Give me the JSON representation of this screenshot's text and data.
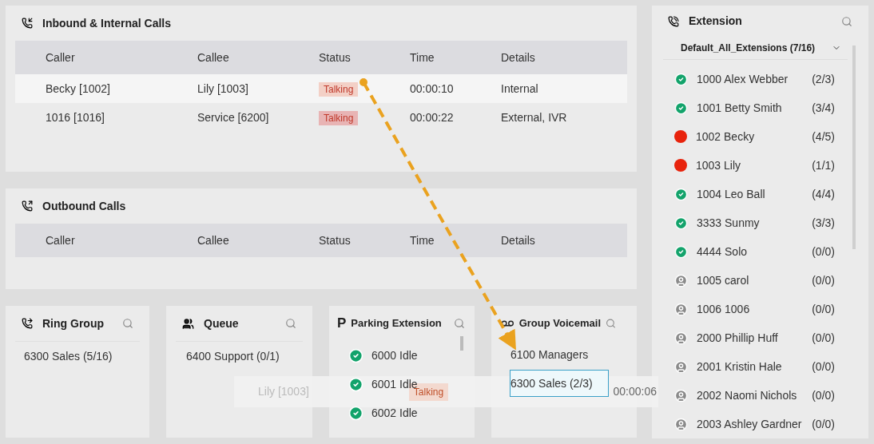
{
  "inbound": {
    "title": "Inbound & Internal Calls",
    "columns": [
      "Caller",
      "Callee",
      "Status",
      "Time",
      "Details"
    ],
    "rows": [
      {
        "caller": "Becky [1002]",
        "callee": "Lily [1003]",
        "status": "Talking",
        "time": "00:00:10",
        "details": "Internal",
        "selected": true
      },
      {
        "caller": "1016 [1016]",
        "callee": "Service [6200]",
        "status": "Talking",
        "time": "00:00:22",
        "details": "External, IVR",
        "selected": false
      }
    ]
  },
  "outbound": {
    "title": "Outbound Calls",
    "columns": [
      "Caller",
      "Callee",
      "Status",
      "Time",
      "Details"
    ]
  },
  "ring_group": {
    "title": "Ring Group",
    "items": [
      "6300 Sales (5/16)"
    ]
  },
  "queue": {
    "title": "Queue",
    "items": [
      "6400 Support (0/1)"
    ]
  },
  "parking": {
    "icon": "P",
    "title": "Parking Extension",
    "items": [
      "6000 Idle",
      "6001 Idle",
      "6002 Idle"
    ]
  },
  "group_voicemail": {
    "title": "Group Voicemail",
    "items": [
      {
        "label": "6100 Managers",
        "highlighted": false
      },
      {
        "label": "6300 Sales (2/3)",
        "highlighted": true
      }
    ]
  },
  "drag_ghost": {
    "callee": "Lily [1003]",
    "status": "Talking",
    "time": "00:00:06"
  },
  "extension": {
    "title": "Extension",
    "group": "Default_All_Extensions (7/16)",
    "items": [
      {
        "name": "1000 Alex Webber",
        "count": "(2/3)",
        "kind": "available"
      },
      {
        "name": "1001 Betty Smith",
        "count": "(3/4)",
        "kind": "available"
      },
      {
        "name": "1002 Becky",
        "count": "(4/5)",
        "kind": "busy"
      },
      {
        "name": "1003 Lily",
        "count": "(1/1)",
        "kind": "busy"
      },
      {
        "name": "1004 Leo Ball",
        "count": "(4/4)",
        "kind": "available"
      },
      {
        "name": "3333 Sunmy",
        "count": "(3/3)",
        "kind": "available"
      },
      {
        "name": "4444 Solo",
        "count": "(0/0)",
        "kind": "available"
      },
      {
        "name": "1005 carol",
        "count": "(0/0)",
        "kind": "offline"
      },
      {
        "name": "1006 1006",
        "count": "(0/0)",
        "kind": "offline"
      },
      {
        "name": "2000 Phillip Huff",
        "count": "(0/0)",
        "kind": "offline"
      },
      {
        "name": "2001 Kristin Hale",
        "count": "(0/0)",
        "kind": "offline"
      },
      {
        "name": "2002 Naomi Nichols",
        "count": "(0/0)",
        "kind": "offline"
      },
      {
        "name": "2003 Ashley Gardner",
        "count": "(0/0)",
        "kind": "offline"
      }
    ]
  }
}
